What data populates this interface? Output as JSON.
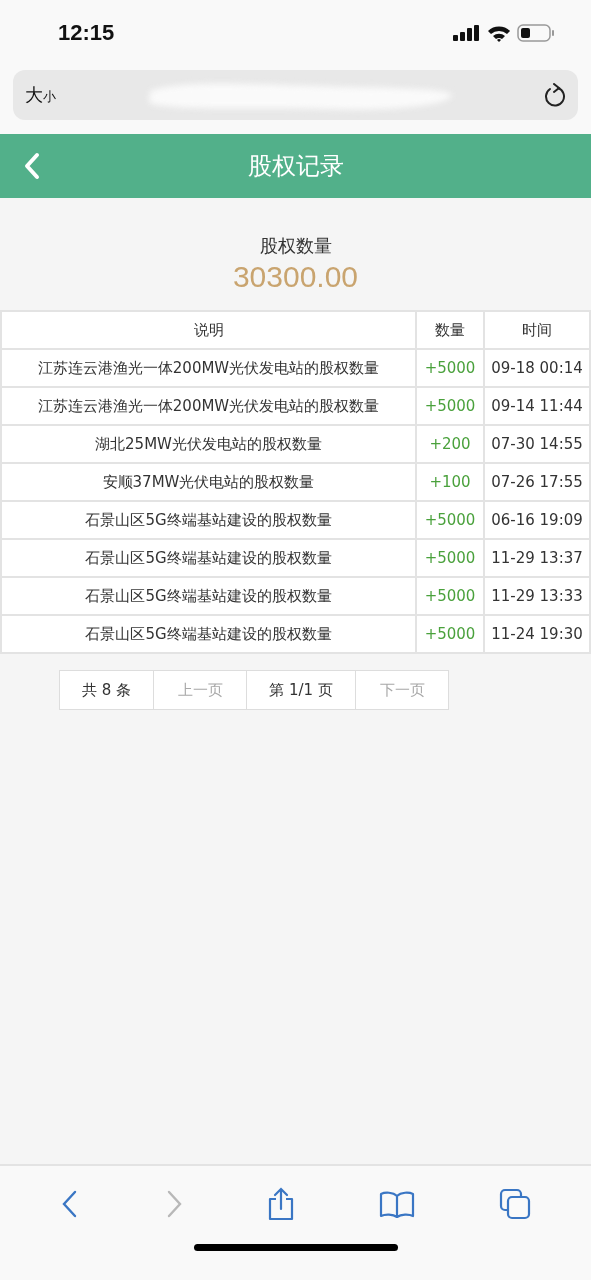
{
  "status_bar": {
    "time": "12:15"
  },
  "address_bar": {
    "text_size_label": "大",
    "text_size_small": "小"
  },
  "header": {
    "title": "股权记录"
  },
  "summary": {
    "label": "股权数量",
    "value": "30300.00"
  },
  "table": {
    "columns": [
      "说明",
      "数量",
      "时间"
    ],
    "rows": [
      {
        "description": "江苏连云港渔光一体200MW光伏发电站的股权数量",
        "amount": "+5000",
        "time": "09-18 00:14"
      },
      {
        "description": "江苏连云港渔光一体200MW光伏发电站的股权数量",
        "amount": "+5000",
        "time": "09-14 11:44"
      },
      {
        "description": "湖北25MW光伏发电站的股权数量",
        "amount": "+200",
        "time": "07-30 14:55"
      },
      {
        "description": "安顺37MW光伏电站的股权数量",
        "amount": "+100",
        "time": "07-26 17:55"
      },
      {
        "description": "石景山区5G终端基站建设的股权数量",
        "amount": "+5000",
        "time": "06-16 19:09"
      },
      {
        "description": "石景山区5G终端基站建设的股权数量",
        "amount": "+5000",
        "time": "11-29 13:37"
      },
      {
        "description": "石景山区5G终端基站建设的股权数量",
        "amount": "+5000",
        "time": "11-29 13:33"
      },
      {
        "description": "石景山区5G终端基站建设的股权数量",
        "amount": "+5000",
        "time": "11-24 19:30"
      }
    ]
  },
  "pagination": [
    {
      "label": "共 8 条",
      "disabled": false
    },
    {
      "label": "上一页",
      "disabled": true
    },
    {
      "label": "第 1/1 页",
      "disabled": false
    },
    {
      "label": "下一页",
      "disabled": true
    }
  ],
  "browser_toolbar": {
    "back_disabled": false,
    "forward_disabled": true
  }
}
